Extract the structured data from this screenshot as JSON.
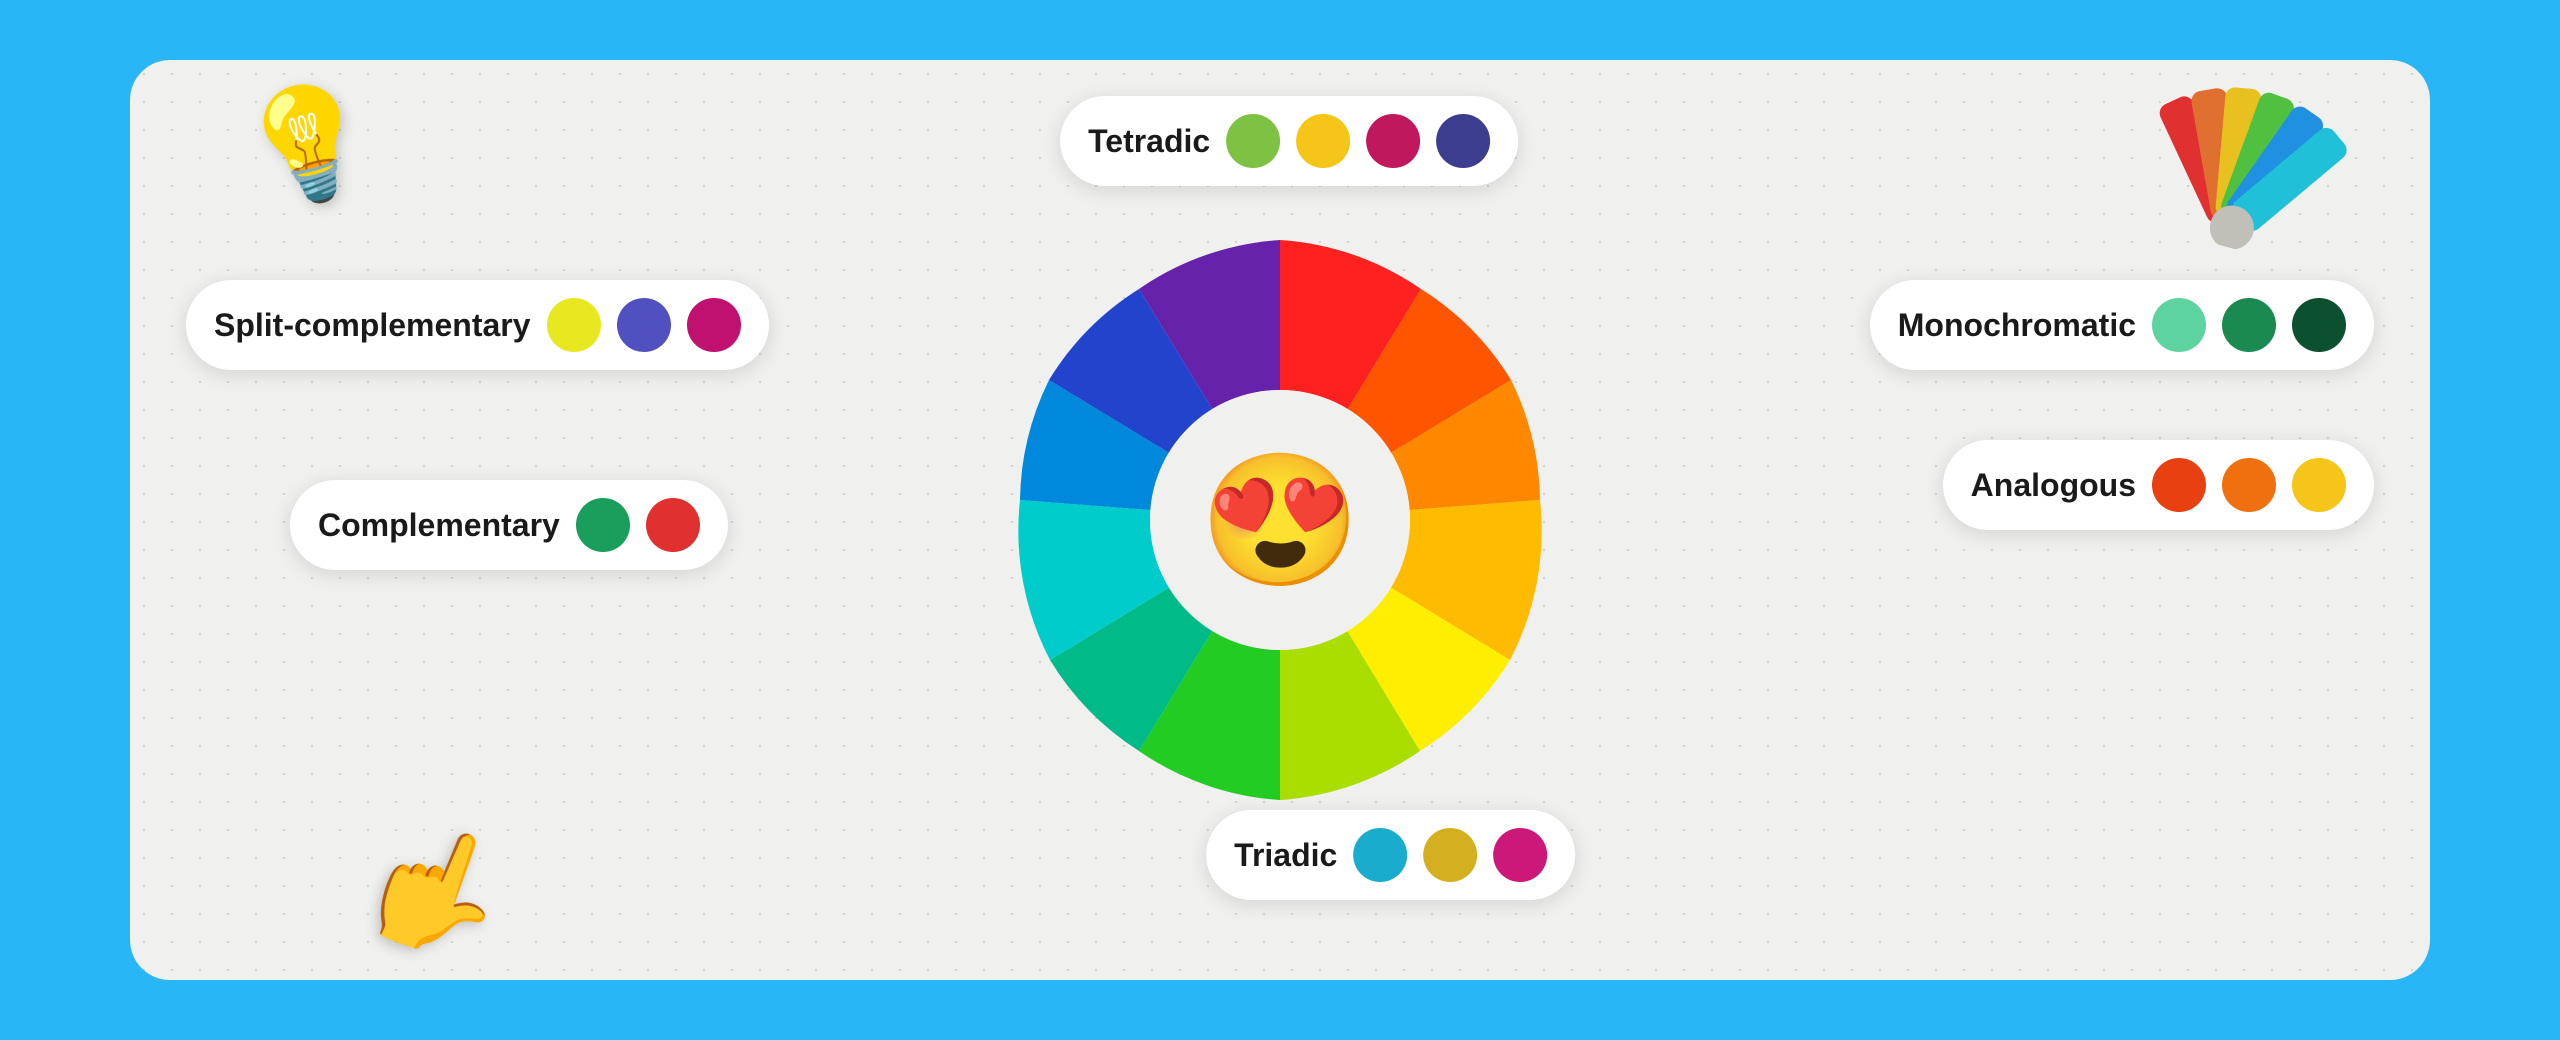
{
  "background_color": "#29b6f6",
  "card": {
    "bg": "#f0f0ee"
  },
  "pills": {
    "tetradic": {
      "label": "Tetradic",
      "colors": [
        "#7dc243",
        "#f5c518",
        "#c0175d",
        "#3d3d8f"
      ]
    },
    "split_complementary": {
      "label": "Split-complementary",
      "colors": [
        "#e8e820",
        "#5050c0",
        "#c01070"
      ]
    },
    "complementary": {
      "label": "Complementary",
      "colors": [
        "#1a9e5c",
        "#e03030"
      ]
    },
    "monochromatic": {
      "label": "Monochromatic",
      "colors": [
        "#5dd4a0",
        "#1a8a50",
        "#0d5030"
      ]
    },
    "analogous": {
      "label": "Analogous",
      "colors": [
        "#e84010",
        "#f07010",
        "#f5c518"
      ]
    },
    "triadic": {
      "label": "Triadic",
      "colors": [
        "#1aaccc",
        "#d4b020",
        "#cc1878"
      ]
    }
  },
  "emoji": "😍",
  "decorations": {
    "lightbulb": "💡",
    "hand": "👉"
  }
}
